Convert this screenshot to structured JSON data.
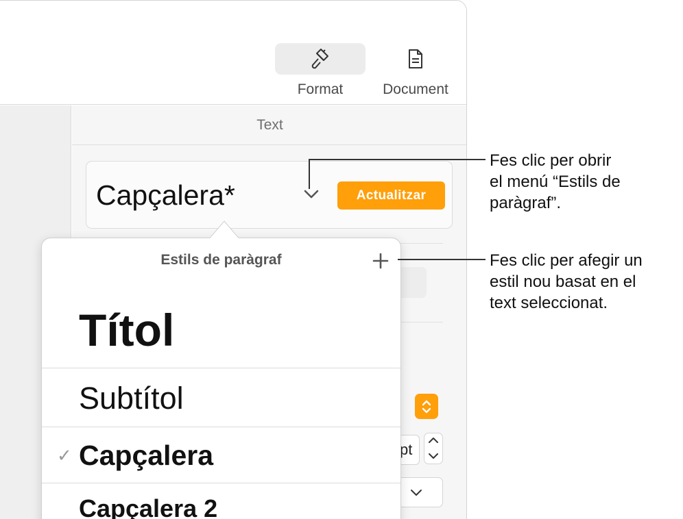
{
  "toolbar": {
    "format_label": "Format",
    "document_label": "Document"
  },
  "sidebar": {
    "title": "Text",
    "current_style": "Capçalera*",
    "update_button": "Actualitzar",
    "font_size_fragment": "pt"
  },
  "popover": {
    "title": "Estils de paràgraf",
    "items": [
      {
        "label": "Títol",
        "checked": false
      },
      {
        "label": "Subtítol",
        "checked": false
      },
      {
        "label": "Capçalera",
        "checked": true
      },
      {
        "label": "Capçalera 2",
        "checked": false
      }
    ]
  },
  "callouts": {
    "menu_line1": "Fes clic per obrir",
    "menu_line2": "el menú “Estils de",
    "menu_line3": "paràgraf”.",
    "add_line1": "Fes clic per afegir un",
    "add_line2": "estil nou basat en el",
    "add_line3": "text seleccionat."
  },
  "colors": {
    "accent": "#ff9f0a",
    "window_border": "#d4d4d4",
    "sidebar_bg": "#f6f6f6"
  }
}
